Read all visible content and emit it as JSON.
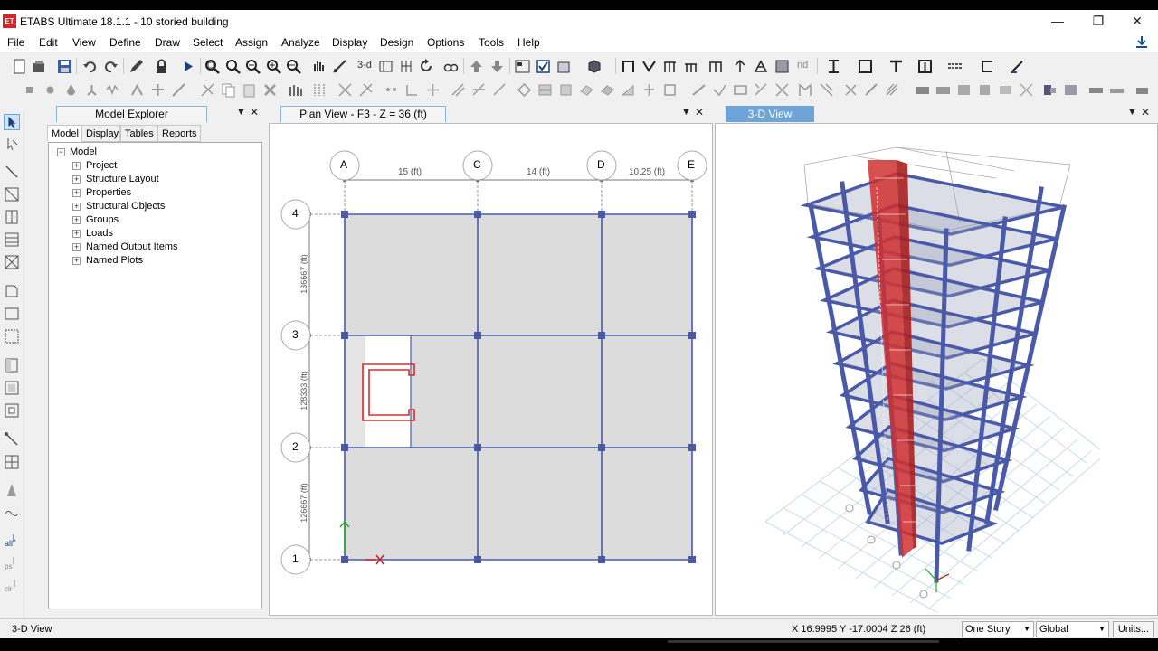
{
  "window": {
    "title": "ETABS Ultimate 18.1.1 - 10 storied building",
    "logo_text": "ET",
    "controls": {
      "minimize": "—",
      "restore": "❐",
      "close": "✕"
    }
  },
  "menu": [
    "File",
    "Edit",
    "View",
    "Define",
    "Draw",
    "Select",
    "Assign",
    "Analyze",
    "Display",
    "Design",
    "Options",
    "Tools",
    "Help"
  ],
  "toolbar": {
    "text_3d": "3-d",
    "text_nd": "nd"
  },
  "explorer": {
    "title": "Model Explorer",
    "tabs": [
      "Model",
      "Display",
      "Tables",
      "Reports"
    ],
    "active_tab": "Model",
    "tree_root": "Model",
    "tree_items": [
      "Project",
      "Structure Layout",
      "Properties",
      "Structural Objects",
      "Groups",
      "Loads",
      "Named Output Items",
      "Named Plots"
    ]
  },
  "plan": {
    "title": "Plan View - F3 - Z = 36 (ft)",
    "grid_x": [
      "A",
      "C",
      "D",
      "E"
    ],
    "grid_y": [
      "4",
      "3",
      "2",
      "1"
    ],
    "dims_x": [
      "15 (ft)",
      "14 (ft)",
      "10.25 (ft)"
    ],
    "dims_y": [
      "136667 (ft)",
      "128333 (ft)",
      "126667 (ft)"
    ]
  },
  "view3d": {
    "title": "3-D View"
  },
  "status": {
    "left": "3-D View",
    "coords": "X 16.9995  Y -17.0004  Z 26 (ft)",
    "story": "One Story",
    "system": "Global",
    "units": "Units..."
  },
  "colors": {
    "accent": "#6ea4d8",
    "frame": "#4a5aa8",
    "wall": "#d03030",
    "slab": "#dcdcdc"
  }
}
